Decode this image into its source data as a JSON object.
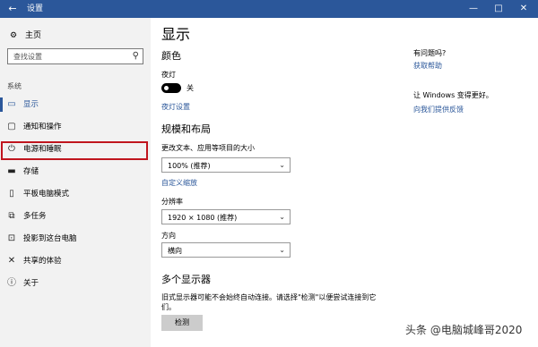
{
  "window": {
    "back_icon": "back-arrow-icon",
    "title": "设置",
    "controls": {
      "minimize": "—",
      "maximize": "□",
      "close": "✕"
    }
  },
  "sidebar": {
    "home_label": "主页",
    "search_placeholder": "查找设置",
    "section_label": "系统",
    "items": [
      {
        "label": "显示",
        "icon": "monitor-icon",
        "active": true
      },
      {
        "label": "通知和操作",
        "icon": "notification-icon"
      },
      {
        "label": "电源和睡眠",
        "icon": "power-icon",
        "highlighted": true
      },
      {
        "label": "存储",
        "icon": "storage-icon"
      },
      {
        "label": "平板电脑模式",
        "icon": "tablet-icon"
      },
      {
        "label": "多任务",
        "icon": "multitask-icon"
      },
      {
        "label": "投影到这台电脑",
        "icon": "project-icon"
      },
      {
        "label": "共享的体验",
        "icon": "share-icon"
      },
      {
        "label": "关于",
        "icon": "info-icon"
      }
    ],
    "highlight_color": "#c0151e"
  },
  "main": {
    "title": "显示",
    "color_heading": "颜色",
    "night_light_label": "夜灯",
    "night_light_state": "关",
    "night_light_settings_link": "夜灯设置",
    "scale_heading": "规模和布局",
    "scale_label": "更改文本、应用等项目的大小",
    "scale_value": "100% (推荐)",
    "custom_scale_link": "自定义缩放",
    "resolution_label": "分辨率",
    "resolution_value": "1920 × 1080 (推荐)",
    "orientation_label": "方向",
    "orientation_value": "横向",
    "multi_display_heading": "多个显示器",
    "multi_display_desc_line1": "旧式显示器可能不会始终自动连接。请选择\"检测\"以便尝试连接到它",
    "multi_display_desc_line2": "们。",
    "detect_button": "检测"
  },
  "side_panel": {
    "question": "有问题吗?",
    "get_help_link": "获取帮助",
    "improve_text": "让 Windows 变得更好。",
    "feedback_link": "向我们提供反馈"
  },
  "watermark": "头条 @电脑城峰哥2020",
  "colors": {
    "accent": "#2b579a",
    "titlebar": "#2b579a",
    "sidebar_bg": "#f2f2f2"
  }
}
